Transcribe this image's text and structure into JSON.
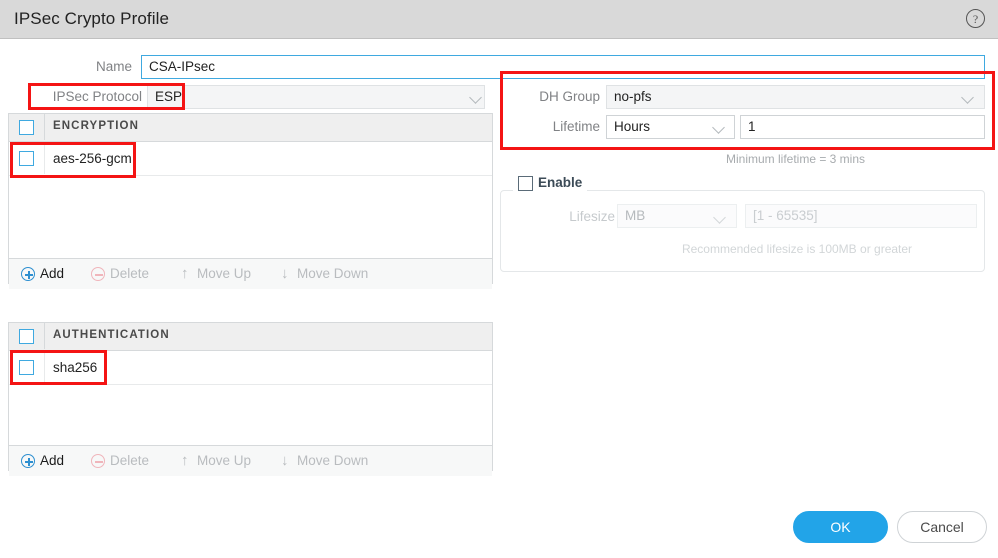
{
  "window": {
    "title": "IPSec Crypto Profile",
    "help_icon": "question-mark-circle-icon"
  },
  "form": {
    "name": {
      "label": "Name",
      "value": "CSA-IPsec"
    },
    "ipsec_protocol": {
      "label": "IPSec Protocol",
      "value": "ESP",
      "caret": "chevron-down-icon"
    },
    "dh_group": {
      "label": "DH Group",
      "value": "no-pfs",
      "caret": "chevron-down-icon"
    },
    "lifetime": {
      "label": "Lifetime",
      "unit_value": "Hours",
      "caret": "chevron-down-icon",
      "amount_value": "1",
      "hint": "Minimum lifetime = 3 mins"
    },
    "lifesize": {
      "enable_label": "Enable",
      "enabled": false,
      "label": "Lifesize",
      "unit_value": "MB",
      "caret": "chevron-down-icon",
      "amount_placeholder": "[1 - 65535]",
      "hint": "Recommended lifesize is 100MB or greater"
    }
  },
  "encryption_list": {
    "header": "ENCRYPTION",
    "rows": [
      {
        "value": "aes-256-gcm",
        "checked": false
      }
    ],
    "toolbar": {
      "add": "Add",
      "delete": "Delete",
      "move_up": "Move Up",
      "move_down": "Move Down",
      "add_icon": "plus-circle-icon",
      "delete_icon": "minus-circle-icon",
      "move_up_icon": "arrow-up-icon",
      "move_down_icon": "arrow-down-icon"
    }
  },
  "authentication_list": {
    "header": "AUTHENTICATION",
    "rows": [
      {
        "value": "sha256",
        "checked": false
      }
    ],
    "toolbar": {
      "add": "Add",
      "delete": "Delete",
      "move_up": "Move Up",
      "move_down": "Move Down",
      "add_icon": "plus-circle-icon",
      "delete_icon": "minus-circle-icon",
      "move_up_icon": "arrow-up-icon",
      "move_down_icon": "arrow-down-icon"
    }
  },
  "footer": {
    "ok": "OK",
    "cancel": "Cancel"
  },
  "colors": {
    "accent_blue": "#22a4e8",
    "checkbox_blue": "#3fa9e0",
    "titlebar_grey": "#d9d9d9",
    "annotation_red": "#f41414"
  },
  "annotations": {
    "count": 4,
    "targets": [
      "ipsec-protocol-field",
      "encryption-row-aes-256-gcm",
      "authentication-row-sha256",
      "dh-group-and-lifetime-group"
    ]
  }
}
